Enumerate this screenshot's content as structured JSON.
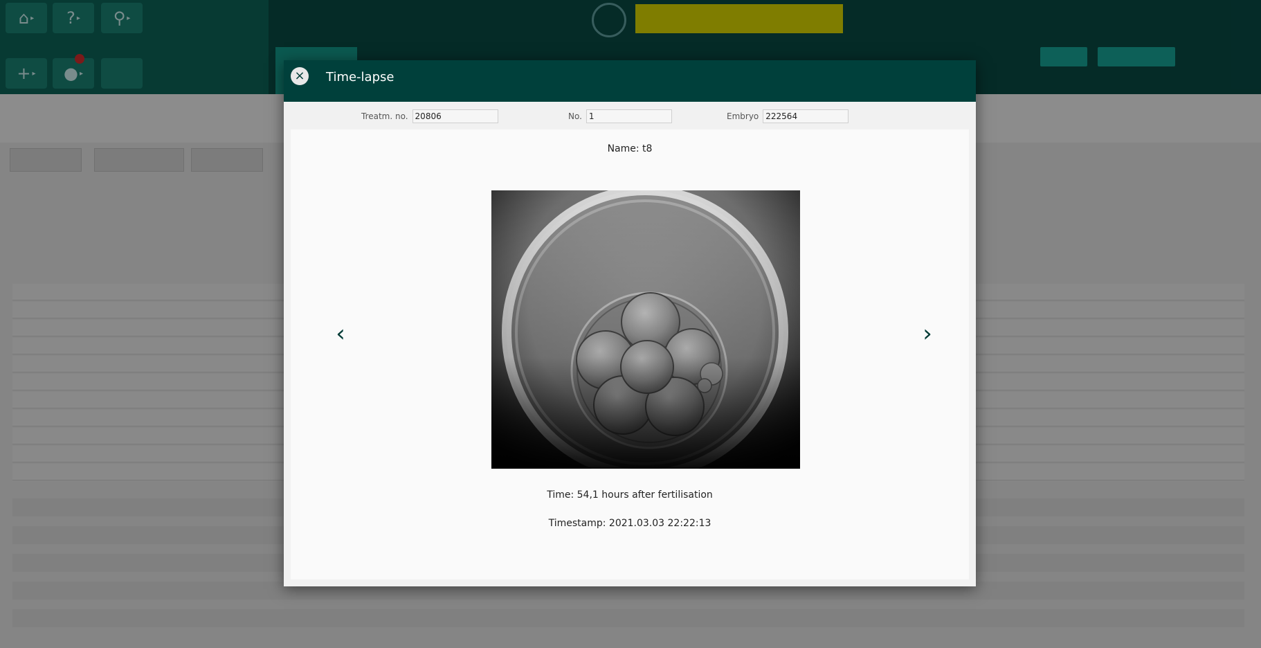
{
  "modal": {
    "title": "Time-lapse",
    "close_icon": "×",
    "fields": {
      "treatment": {
        "label": "Treatm. no.",
        "value": "20806"
      },
      "number": {
        "label": "No.",
        "value": "1"
      },
      "embryo": {
        "label": "Embryo",
        "value": "222564"
      }
    },
    "image_name": "Name: t8",
    "time_text": "Time: 54,1 hours after fertilisation",
    "timestamp_text": "Timestamp: 2021.03.03 22:22:13",
    "prev_icon": "‹",
    "next_icon": "›"
  },
  "background": {
    "toolbar_icons": [
      "home-icon",
      "help-icon",
      "search-icon",
      "add-icon",
      "chat-icon",
      "blank-icon"
    ]
  },
  "colors": {
    "modal_header": "#00403b",
    "accent": "#0e6a5e"
  }
}
